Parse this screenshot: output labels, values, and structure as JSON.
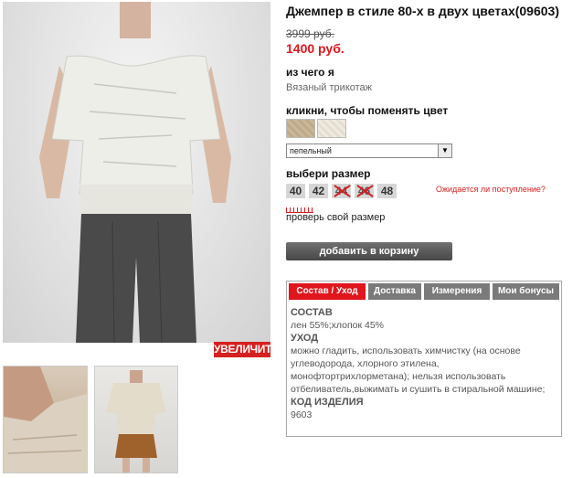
{
  "product": {
    "title": "Джемпер в стиле 80-х в двух цветах(09603)",
    "old_price": "3999 руб.",
    "new_price": "1400 руб."
  },
  "gallery": {
    "zoom_label": "УВЕЛИЧИТЬ"
  },
  "material": {
    "label": "из чего я",
    "value": "Вязаный трикотаж"
  },
  "color": {
    "label": "кликни, чтобы поменять цвет",
    "selected": "пепельный"
  },
  "sizes": {
    "label": "выбери размер",
    "items": [
      {
        "value": "40",
        "available": true
      },
      {
        "value": "42",
        "available": true
      },
      {
        "value": "44",
        "available": false
      },
      {
        "value": "46",
        "available": false
      },
      {
        "value": "48",
        "available": true
      }
    ],
    "expected_link": "Ожидается ли поступление?",
    "check_label": "проверь свой размер"
  },
  "cart": {
    "button_label": "добавить в корзину"
  },
  "tabs": {
    "items": [
      "Состав / Уход",
      "Доставка",
      "Измерения",
      "Мои бонусы"
    ],
    "active": 0,
    "content": {
      "composition_heading": "СОСТАВ",
      "composition": "лен 55%;хлопок 45%",
      "care_heading": "УХОД",
      "care": "можно гладить, использовать химчистку (на основе углеводорода, хлорного этилена, монофтортрихлорметана); нельзя использовать отбеливатель,выжимать и сушить в стиральной машине;",
      "code_heading": "КОД ИЗДЕЛИЯ",
      "code": "9603"
    }
  },
  "colors": {
    "accent": "#e1151c",
    "tab_inactive": "#7a7a7a",
    "button": "#555555"
  }
}
